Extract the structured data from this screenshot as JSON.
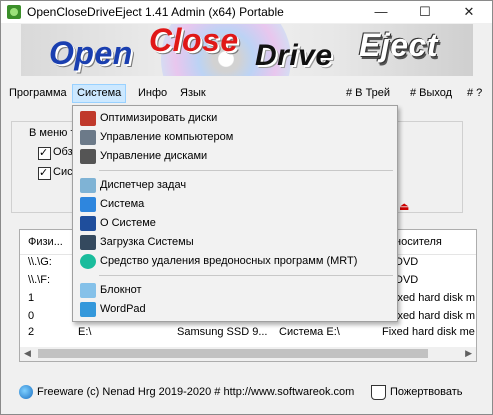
{
  "window": {
    "title": "OpenCloseDriveEject 1.41 Admin (x64) Portable",
    "controls": {
      "minimize": "—",
      "maximize": "☐",
      "close": "✕"
    }
  },
  "banner": {
    "word_open": "Open",
    "word_close": "Close",
    "word_drive": "Drive",
    "word_eject": "Eject"
  },
  "menu": {
    "program": "Программа",
    "system": "Система",
    "info": "Инфо",
    "language": "Язык",
    "to_tray": "# В Трей",
    "exit": "# Выход",
    "help": "# ?"
  },
  "settings": {
    "group_label": "В меню т",
    "checkbox1_label": "Обз",
    "checkbox2_label": "Сис"
  },
  "dropdown": {
    "items": [
      "Оптимизировать диски",
      "Управление компьютером",
      "Управление дисками",
      "Диспетчер задач",
      "Система",
      "О Системе",
      "Загрузка Системы",
      "Средство удаления вредоносных программ (MRT)",
      "Блокнот",
      "WordPad"
    ]
  },
  "table": {
    "headers": [
      "Физи...",
      "носителя"
    ],
    "rows": [
      [
        "\\\\.\\G:",
        "",
        "",
        "",
        "DVD"
      ],
      [
        "\\\\.\\F:",
        "",
        "",
        "",
        "DVD"
      ],
      [
        "1",
        "",
        "",
        "",
        "ixed hard disk medi"
      ],
      [
        "0",
        "",
        "",
        "",
        "ixed hard disk medi"
      ],
      [
        "2",
        "E:\\",
        "Samsung SSD 9...",
        "Система E:\\",
        "Fixed hard disk medi"
      ]
    ]
  },
  "footer": {
    "text": "Freeware (c) Nenad Hrg 2019-2020 # http://www.softwareok.com",
    "donate": "Пожертвовать"
  },
  "colors": {
    "accent": "#cce8ff",
    "open_blue": "#1a3fb0",
    "close_red": "#e01818"
  }
}
